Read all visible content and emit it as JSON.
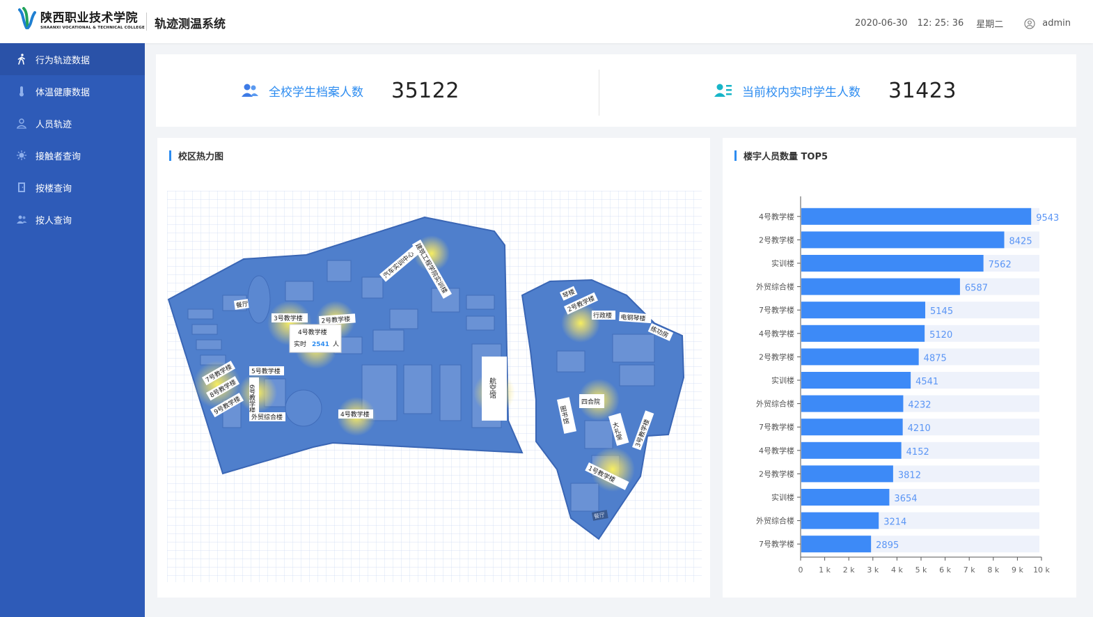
{
  "header": {
    "logo_cn": "陕西职业技术学院",
    "logo_en": "SHAANXI VOCATIONAL & TECHNICAL COLLEGE",
    "system_title": "轨迹测温系统",
    "date": "2020-06-30",
    "time": "12: 25: 36",
    "weekday": "星期二",
    "username": "admin"
  },
  "sidebar": {
    "items": [
      {
        "label": "行为轨迹数据",
        "icon": "walking-person-icon"
      },
      {
        "label": "体温健康数据",
        "icon": "thermometer-icon"
      },
      {
        "label": "人员轨迹",
        "icon": "location-person-icon"
      },
      {
        "label": "接触者查询",
        "icon": "virus-icon"
      },
      {
        "label": "按楼查询",
        "icon": "door-icon"
      },
      {
        "label": "按人查询",
        "icon": "people-icon"
      }
    ],
    "active_index": 0
  },
  "stats": {
    "total_label": "全校学生档案人数",
    "total_value": "35122",
    "current_label": "当前校内实时学生人数",
    "current_value": "31423"
  },
  "map_panel": {
    "title": "校区热力图",
    "labels": {
      "canteen": "餐厅",
      "automotive_center": "汽车实训中心",
      "civil_engineering": "建筑工程学院实训楼",
      "building3": "3号教学楼",
      "building2": "2号教学楼",
      "building4_tooltip": "4号教学楼",
      "realtime_prefix": "实时",
      "realtime_count": "2541",
      "realtime_unit": "人",
      "building7": "7号教学楼",
      "building8": "8号教学楼",
      "building9": "9号教学楼",
      "building5": "5号教学楼",
      "building6": "6号教学楼",
      "foreign_trade": "外贸综合楼",
      "building4": "4号教学楼",
      "aviation": "航空馆",
      "piano": "琴楼",
      "building2b": "2号教学楼",
      "admin_building": "行政楼",
      "piano_room": "电钢琴楼",
      "training_hall": "练功房",
      "courtyard": "四合院",
      "library": "图书馆",
      "auditorium": "大礼堂",
      "building1": "1号教学楼",
      "building3b": "3号教学楼",
      "canteen_b": "餐厅"
    }
  },
  "chart_panel": {
    "title": "楼宇人员数量 TOP5"
  },
  "chart_data": {
    "type": "bar",
    "orientation": "horizontal",
    "title": "楼宇人员数量 TOP5",
    "categories": [
      "4号教学楼",
      "2号教学楼",
      "实训楼",
      "外贸综合楼",
      "7号教学楼",
      "4号教学楼",
      "2号教学楼",
      "实训楼",
      "外贸综合楼",
      "7号教学楼",
      "4号教学楼",
      "2号教学楼",
      "实训楼",
      "外贸综合楼",
      "7号教学楼"
    ],
    "values": [
      9543,
      8425,
      7562,
      6587,
      5145,
      5120,
      4875,
      4541,
      4232,
      4210,
      4152,
      3812,
      3654,
      3214,
      2895
    ],
    "xlim": [
      0,
      10000
    ],
    "xticks": [
      "0",
      "1 k",
      "2 k",
      "3 k",
      "4 k",
      "5 k",
      "6 k",
      "7 k",
      "8 k",
      "9 k",
      "10 k"
    ],
    "bar_color": "#3d8af7",
    "track_color": "#eef2fb",
    "label_color": "#5a95f5"
  }
}
